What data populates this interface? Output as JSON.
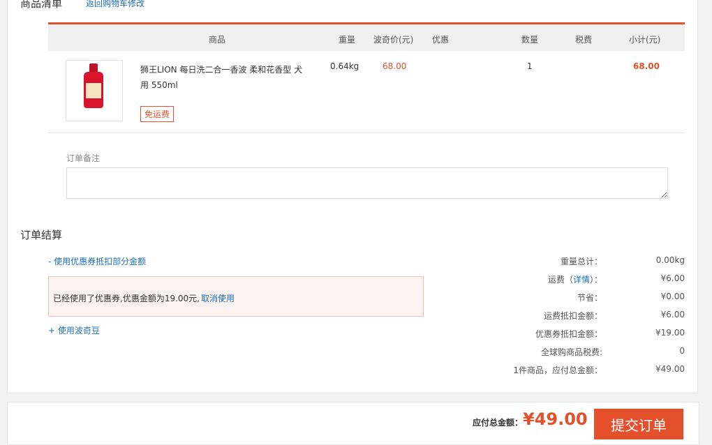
{
  "section": {
    "title": "商品清单",
    "back_link": "返回购物车修改"
  },
  "table": {
    "headers": [
      "商品",
      "重量",
      "波奇价(元)",
      "优惠",
      "数量",
      "税费",
      "小计(元)"
    ]
  },
  "product": {
    "name": "狮王LION 每日洗二合一香波 柔和花香型 犬用 550ml",
    "badge": "免运费",
    "weight": "0.64kg",
    "price": "68.00",
    "quantity": "1",
    "subtotal": "68.00"
  },
  "remark": {
    "label": "订单备注",
    "value": ""
  },
  "settlement": {
    "title": "订单结算",
    "coupon_toggle": "- 使用优惠券抵扣部分金额",
    "coupon_used_text": "已经使用了优惠券,优惠金额为19.00元,",
    "coupon_cancel": "取消使用",
    "bean_toggle": "+ 使用波奇豆"
  },
  "summary": {
    "weight_label": "重量总计：",
    "weight_value": "0.00kg",
    "shipping_label_pre": "运费（",
    "shipping_detail": "详情",
    "shipping_label_post": "）：",
    "shipping_value": "¥6.00",
    "saved_label": "节省：",
    "saved_value": "¥0.00",
    "shipping_deduct_label": "运费抵扣金额：",
    "shipping_deduct_value": "¥6.00",
    "coupon_deduct_label": "优惠券抵扣金额：",
    "coupon_deduct_value": "¥19.00",
    "tax_label": "全球购商品税费:",
    "tax_value": "0",
    "payable_label": "1件商品，应付总金额：",
    "payable_value": "¥49.00"
  },
  "footer": {
    "total_label": "应付总金额：",
    "total_value": "¥49.00",
    "submit": "提交订单"
  },
  "colors": {
    "accent": "#e4502c",
    "link": "#1c6fb8"
  }
}
